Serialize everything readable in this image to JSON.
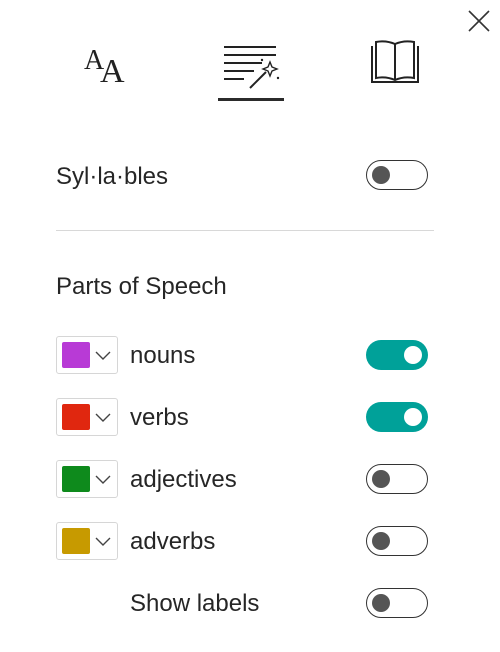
{
  "syllables": {
    "label": "Syl·la·bles",
    "enabled": false
  },
  "parts_of_speech": {
    "heading": "Parts of Speech",
    "items": [
      {
        "label": "nouns",
        "color": "#b83ad6",
        "enabled": true
      },
      {
        "label": "verbs",
        "color": "#e0270f",
        "enabled": true
      },
      {
        "label": "adjectives",
        "color": "#0e8a1c",
        "enabled": false
      },
      {
        "label": "adverbs",
        "color": "#c79a00",
        "enabled": false
      }
    ],
    "show_labels": {
      "label": "Show labels",
      "enabled": false
    }
  },
  "colors": {
    "accent": "#00a199",
    "text": "#262626",
    "divider": "#d8d8d8"
  },
  "icons": {
    "close": "close-icon",
    "text_preferences": "text-size-icon",
    "grammar_options": "grammar-options-icon",
    "reading_preferences": "book-icon",
    "dropdown": "chevron-down-icon"
  }
}
